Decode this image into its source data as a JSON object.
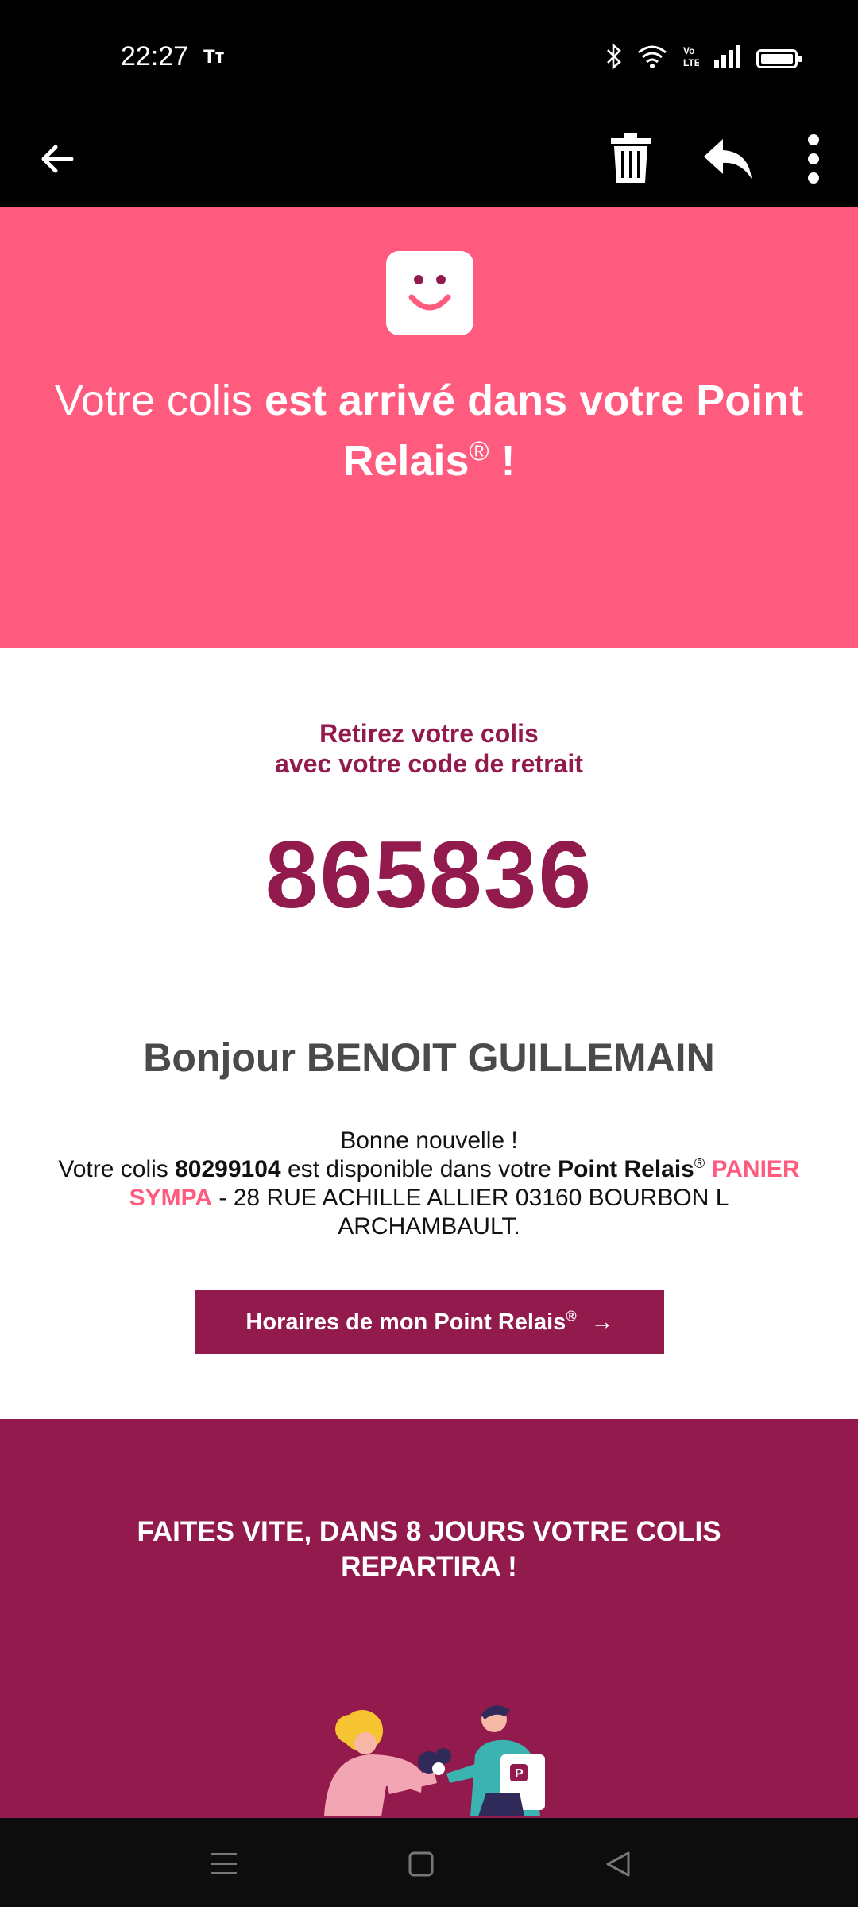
{
  "status_bar": {
    "time": "22:27",
    "text_size_indicator": "Tт",
    "icons": [
      "bluetooth-icon",
      "wifi-icon",
      "volte-icon",
      "signal-icon",
      "battery-icon"
    ]
  },
  "toolbar": {
    "icons": [
      "back-arrow-icon",
      "trash-icon",
      "reply-icon",
      "more-vertical-icon"
    ]
  },
  "hero": {
    "title_regular": "Votre colis ",
    "title_bold": "est arrivé dans votre Point Relais",
    "title_registered": "®",
    "title_end": " !",
    "logo_icon": "smiley-logo-icon",
    "background_color": "#ff5b7f"
  },
  "pickup": {
    "line1": "Retirez votre colis",
    "line2": "avec votre code de retrait",
    "code": "865836"
  },
  "greeting": "Bonjour BENOIT GUILLEMAIN",
  "message": {
    "line1": "Bonne nouvelle !",
    "part1": "Votre colis ",
    "parcel_number": "80299104",
    "part2": " est disponible dans votre ",
    "point_relais": "Point Relais",
    "registered": "®",
    "shop_name": "PANIER SYMPA",
    "address": " - 28 RUE ACHILLE ALLIER 03160 BOURBON L ARCHAMBAULT."
  },
  "button": {
    "label": "Horaires de mon Point Relais",
    "registered": "®",
    "arrow": "→"
  },
  "promo": {
    "title": "FAITES VITE, DANS 8 JOURS VOTRE COLIS REPARTIRA !",
    "background_color": "#931a4c"
  },
  "navbar": {
    "icons": [
      "menu-icon",
      "home-icon",
      "back-icon"
    ]
  },
  "colors": {
    "accent": "#931a4c",
    "pink": "#ff5b7f"
  }
}
